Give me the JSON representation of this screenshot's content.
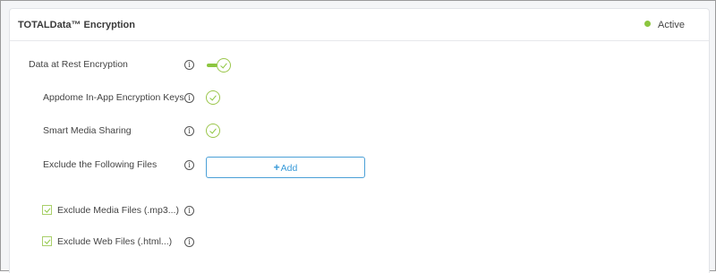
{
  "header": {
    "title": "TOTALData™ Encryption",
    "status_label": "Active",
    "status_color": "#8cc63f"
  },
  "rows": {
    "data_at_rest": {
      "label": "Data at Rest Encryption",
      "enabled": true
    },
    "appdome_keys": {
      "label": "Appdome In-App Encryption Keys",
      "enabled": true
    },
    "smart_media": {
      "label": "Smart Media Sharing",
      "enabled": true
    },
    "exclude_files": {
      "label": "Exclude the Following Files",
      "add_label": "Add"
    },
    "exclude_media": {
      "label": "Exclude Media Files (.mp3...)",
      "checked": true
    },
    "exclude_web": {
      "label": "Exclude Web Files (.html...)",
      "checked": true
    }
  },
  "icons": {
    "info": "info-icon",
    "check": "check-icon",
    "plus": "plus-icon"
  },
  "colors": {
    "accent_green": "#8cc63f",
    "add_button_blue": "#3a9bd9"
  }
}
